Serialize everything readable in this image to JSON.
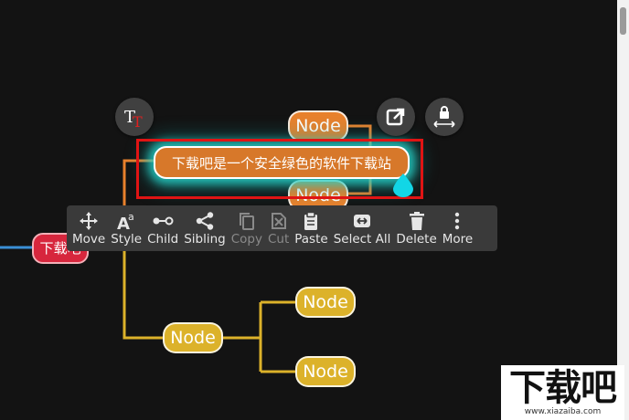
{
  "mindmap": {
    "root_label": "下载吧",
    "selected_label": "下载吧是一个安全绿色的软件下载站",
    "node_label": "Node"
  },
  "toolbar": {
    "items": [
      {
        "label": "Move",
        "icon": "move-icon"
      },
      {
        "label": "Style",
        "icon": "style-icon"
      },
      {
        "label": "Child",
        "icon": "child-icon"
      },
      {
        "label": "Sibling",
        "icon": "sibling-icon"
      },
      {
        "label": "Copy",
        "icon": "copy-icon"
      },
      {
        "label": "Cut",
        "icon": "cut-icon"
      },
      {
        "label": "Paste",
        "icon": "paste-icon"
      },
      {
        "label": "Select All",
        "icon": "select-all-icon"
      },
      {
        "label": "Delete",
        "icon": "delete-icon"
      },
      {
        "label": "More",
        "icon": "more-vertical-icon"
      }
    ]
  },
  "floating_buttons": [
    "text-format-icon",
    "open-external-icon",
    "lock-width-icon"
  ],
  "watermark": {
    "title": "下载吧",
    "url": "www.xiazaiba.com"
  },
  "colors": {
    "background": "#131313",
    "orange_branch": "#e8812c",
    "yellow_branch": "#dcb22a",
    "root_node": "#d7263d",
    "selection_glow": "#28dcd2",
    "highlight_box": "#e01414",
    "toolbar_bg": "#3a3a3a"
  }
}
